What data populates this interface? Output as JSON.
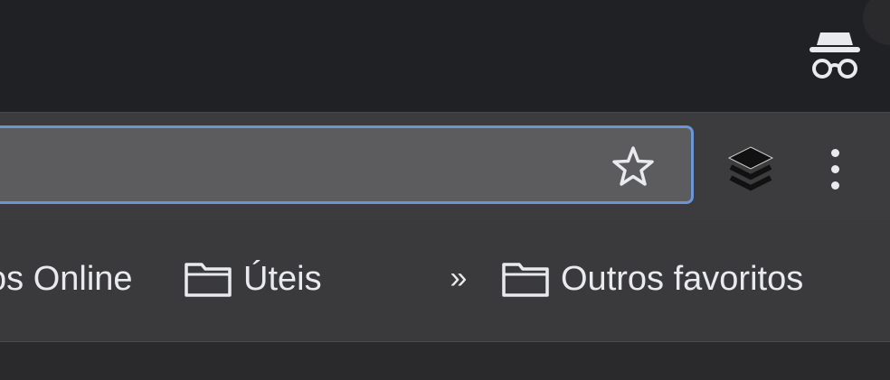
{
  "window": {
    "incognito_icon": "incognito-icon",
    "accent_color": "#6a96d6",
    "background_color": "#202124"
  },
  "toolbar": {
    "address_value": "",
    "bookmark_star_icon": "star-outline-icon",
    "extension_icon": "layers-icon",
    "menu_icon": "vertical-dots-icon"
  },
  "bookmarks": {
    "items": [
      {
        "label": "os Online",
        "icon": "none"
      },
      {
        "label": "Úteis",
        "icon": "folder-icon"
      }
    ],
    "overflow_label": "»",
    "other_bookmarks": {
      "label": "Outros favoritos",
      "icon": "folder-icon"
    }
  }
}
